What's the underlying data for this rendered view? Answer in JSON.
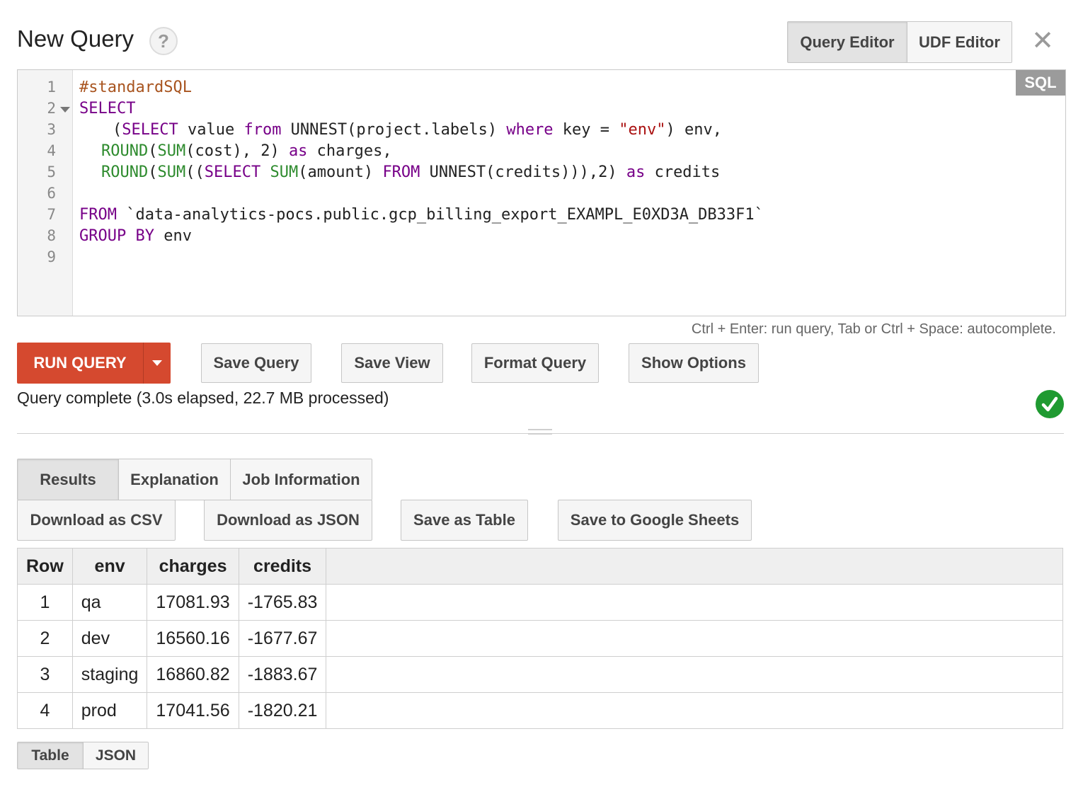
{
  "header": {
    "title": "New Query",
    "help_label": "?",
    "close_label": "✕",
    "tabs": [
      {
        "label": "Query Editor",
        "active": true
      },
      {
        "label": "UDF Editor",
        "active": false
      }
    ]
  },
  "editor": {
    "language_badge": "SQL",
    "lines": [
      "1",
      "2",
      "3",
      "4",
      "5",
      "6",
      "7",
      "8",
      "9"
    ],
    "code": {
      "l1": "#standardSQL",
      "l2": "SELECT",
      "l3": [
        "(",
        "SELECT",
        " value ",
        "from",
        " UNNEST(project.labels) ",
        "where",
        " key = ",
        "\"env\"",
        ") env,"
      ],
      "l4": [
        "ROUND",
        "(",
        "SUM",
        "(cost), 2) ",
        "as",
        " charges,"
      ],
      "l5": [
        "ROUND",
        "(",
        "SUM",
        "((",
        "SELECT",
        " ",
        "SUM",
        "(amount) ",
        "FROM",
        " UNNEST(credits))),2) ",
        "as",
        " credits"
      ],
      "l7": [
        "FROM",
        " `data-analytics-pocs.public.gcp_billing_export_EXAMPL_E0XD3A_DB33F1`"
      ],
      "l8": [
        "GROUP BY",
        " env"
      ]
    }
  },
  "hint": "Ctrl + Enter: run query, Tab or Ctrl + Space: autocomplete.",
  "actions": {
    "run": "RUN QUERY",
    "save_query": "Save Query",
    "save_view": "Save View",
    "format_query": "Format Query",
    "show_options": "Show Options"
  },
  "status": "Query complete (3.0s elapsed, 22.7 MB processed)",
  "result_tabs": [
    "Results",
    "Explanation",
    "Job Information"
  ],
  "result_actions": {
    "download_csv": "Download as CSV",
    "download_json": "Download as JSON",
    "save_table": "Save as Table",
    "save_sheets": "Save to Google Sheets"
  },
  "table": {
    "columns": [
      "Row",
      "env",
      "charges",
      "credits"
    ],
    "rows": [
      [
        "1",
        "qa",
        "17081.93",
        "-1765.83"
      ],
      [
        "2",
        "dev",
        "16560.16",
        "-1677.67"
      ],
      [
        "3",
        "staging",
        "16860.82",
        "-1883.67"
      ],
      [
        "4",
        "prod",
        "17041.56",
        "-1820.21"
      ]
    ]
  },
  "view_tabs": [
    {
      "label": "Table",
      "active": true
    },
    {
      "label": "JSON",
      "active": false
    }
  ],
  "colors": {
    "run_button": "#d5492f",
    "success": "#1f9a31",
    "keyword": "#770088",
    "function": "#2e8b2e",
    "string": "#aa1111",
    "comment": "#a8541f"
  }
}
